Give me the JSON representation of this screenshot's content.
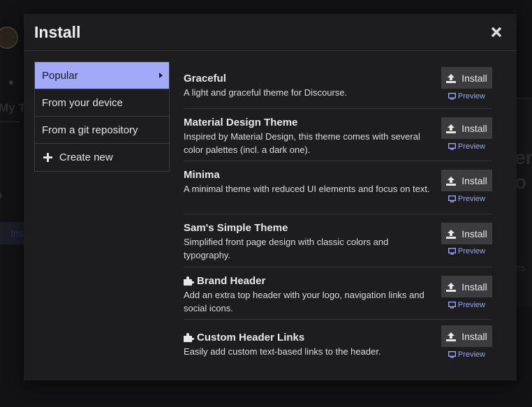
{
  "background": {
    "side_text": "My T",
    "side_button": "Ins",
    "right_text_1": "en",
    "right_text_2": "o",
    "right_text_3": "es"
  },
  "modal": {
    "title": "Install",
    "close_icon": "close-icon"
  },
  "nav": {
    "items": [
      {
        "label": "Popular",
        "active": true
      },
      {
        "label": "From your device",
        "active": false
      },
      {
        "label": "From a git repository",
        "active": false
      },
      {
        "label": "Create new",
        "active": false,
        "icon": "plus-icon"
      }
    ]
  },
  "themes": [
    {
      "name": "Graceful",
      "description": "A light and graceful theme for Discourse.",
      "component": false,
      "install_label": "Install",
      "preview_label": "Preview"
    },
    {
      "name": "Material Design Theme",
      "description": "Inspired by Material Design, this theme comes with several color palettes (incl. a dark one).",
      "component": false,
      "install_label": "Install",
      "preview_label": "Preview"
    },
    {
      "name": "Minima",
      "description": "A minimal theme with reduced UI elements and focus on text.",
      "component": false,
      "install_label": "Install",
      "preview_label": "Preview"
    },
    {
      "name": "Sam's Simple Theme",
      "description": "Simplified front page design with classic colors and typography.",
      "component": false,
      "install_label": "Install",
      "preview_label": "Preview"
    },
    {
      "name": "Brand Header",
      "description": "Add an extra top header with your logo, navigation links and social icons.",
      "component": true,
      "install_label": "Install",
      "preview_label": "Preview"
    },
    {
      "name": "Custom Header Links",
      "description": "Easily add custom text-based links to the header.",
      "component": true,
      "install_label": "Install",
      "preview_label": "Preview"
    }
  ],
  "colors": {
    "accent": "#a2a9f8",
    "link": "#99a4f0",
    "modal_bg": "#1d1d20",
    "button_bg": "#3c3c40"
  }
}
